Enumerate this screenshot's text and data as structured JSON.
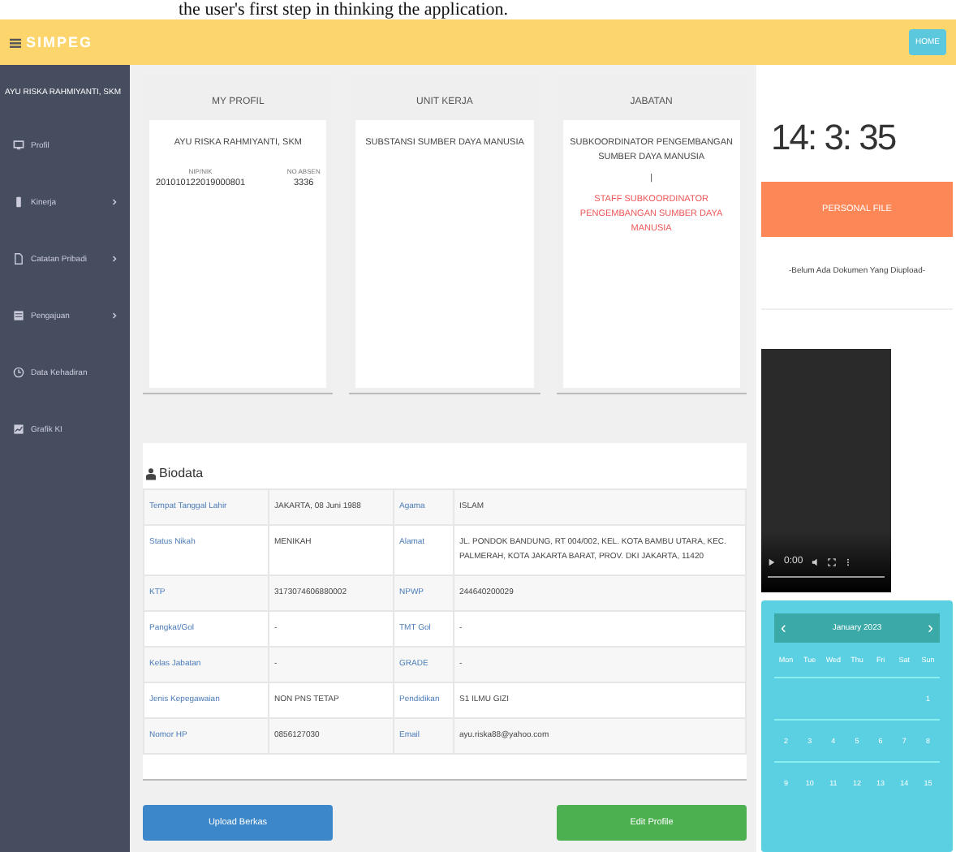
{
  "caption": "the user's first step in thinking the application.",
  "header": {
    "brand": "SIMPEG",
    "button": "HOME"
  },
  "sidebar": {
    "user": "AYU RISKA RAHMIYANTI, SKM",
    "items": [
      {
        "label": "Profil",
        "expandable": false
      },
      {
        "label": "Kinerja",
        "expandable": true
      },
      {
        "label": "Catatan Pribadi",
        "expandable": true
      },
      {
        "label": "Pengajuan",
        "expandable": true
      },
      {
        "label": "Data Kehadiran",
        "expandable": false
      },
      {
        "label": "Grafik KI",
        "expandable": false
      }
    ]
  },
  "cards": [
    {
      "title": "MY PROFIL",
      "kind": "profile",
      "name": "AYU RISKA RAHMIYANTI, SKM",
      "fields": [
        {
          "label": "NIP/NIK",
          "value": "201010122019000801"
        },
        {
          "label": "NO ABSEN",
          "value": "3336"
        }
      ]
    },
    {
      "title": "UNIT KERJA",
      "kind": "text",
      "lines": [
        "SUBSTANSI SUMBER DAYA MANUSIA"
      ]
    },
    {
      "title": "JABATAN",
      "kind": "position",
      "main": "SUBKOORDINATOR PENGEMBANGAN SUMBER DAYA MANUSIA",
      "separator": "|",
      "sub": "STAFF SUBKOORDINATOR PENGEMBANGAN SUMBER DAYA MANUSIA"
    }
  ],
  "biodata": {
    "title": "Biodata",
    "rows": [
      [
        "Tempat Tanggal Lahir",
        "JAKARTA, 08 Juni 1988",
        "Agama",
        "ISLAM"
      ],
      [
        "Status Nikah",
        "MENIKAH",
        "Alamat",
        "JL. PONDOK BANDUNG, RT 004/002, KEL. KOTA BAMBU UTARA, KEC. PALMERAH, KOTA JAKARTA BARAT, PROV. DKI JAKARTA, 11420"
      ],
      [
        "KTP",
        "3173074606880002",
        "NPWP",
        "244640200029"
      ],
      [
        "Pangkat/Gol",
        "-",
        "TMT Gol",
        "-"
      ],
      [
        "Kelas Jabatan",
        "-",
        "GRADE",
        "-"
      ],
      [
        "Jenis Kepegawaian",
        "NON PNS TETAP",
        "Pendidikan",
        "S1 ILMU GIZI"
      ],
      [
        "Nomor HP",
        "0856127030",
        "Email",
        "ayu.riska88@yahoo.com"
      ]
    ]
  },
  "buttons": [
    {
      "label": "Upload Berkas",
      "kind": "primary"
    },
    {
      "label": "Edit Profile",
      "kind": "success"
    }
  ],
  "clock": "14: 3: 35",
  "personal_file": {
    "button": "PERSONAL FILE",
    "empty_text": "-Belum Ada Dokumen Yang Diupload-"
  },
  "video": {
    "time": "0:00"
  },
  "calendar": {
    "month": "January 2023",
    "prev": "‹",
    "next": "›",
    "weekdays": [
      "Mon",
      "Tue",
      "Wed",
      "Thu",
      "Fri",
      "Sat",
      "Sun"
    ],
    "weeks": [
      [
        "1"
      ],
      [
        "2",
        "3",
        "4",
        "5",
        "6",
        "7",
        "8"
      ],
      [
        "9",
        "10",
        "11",
        "12",
        "13",
        "14",
        "15"
      ]
    ]
  }
}
